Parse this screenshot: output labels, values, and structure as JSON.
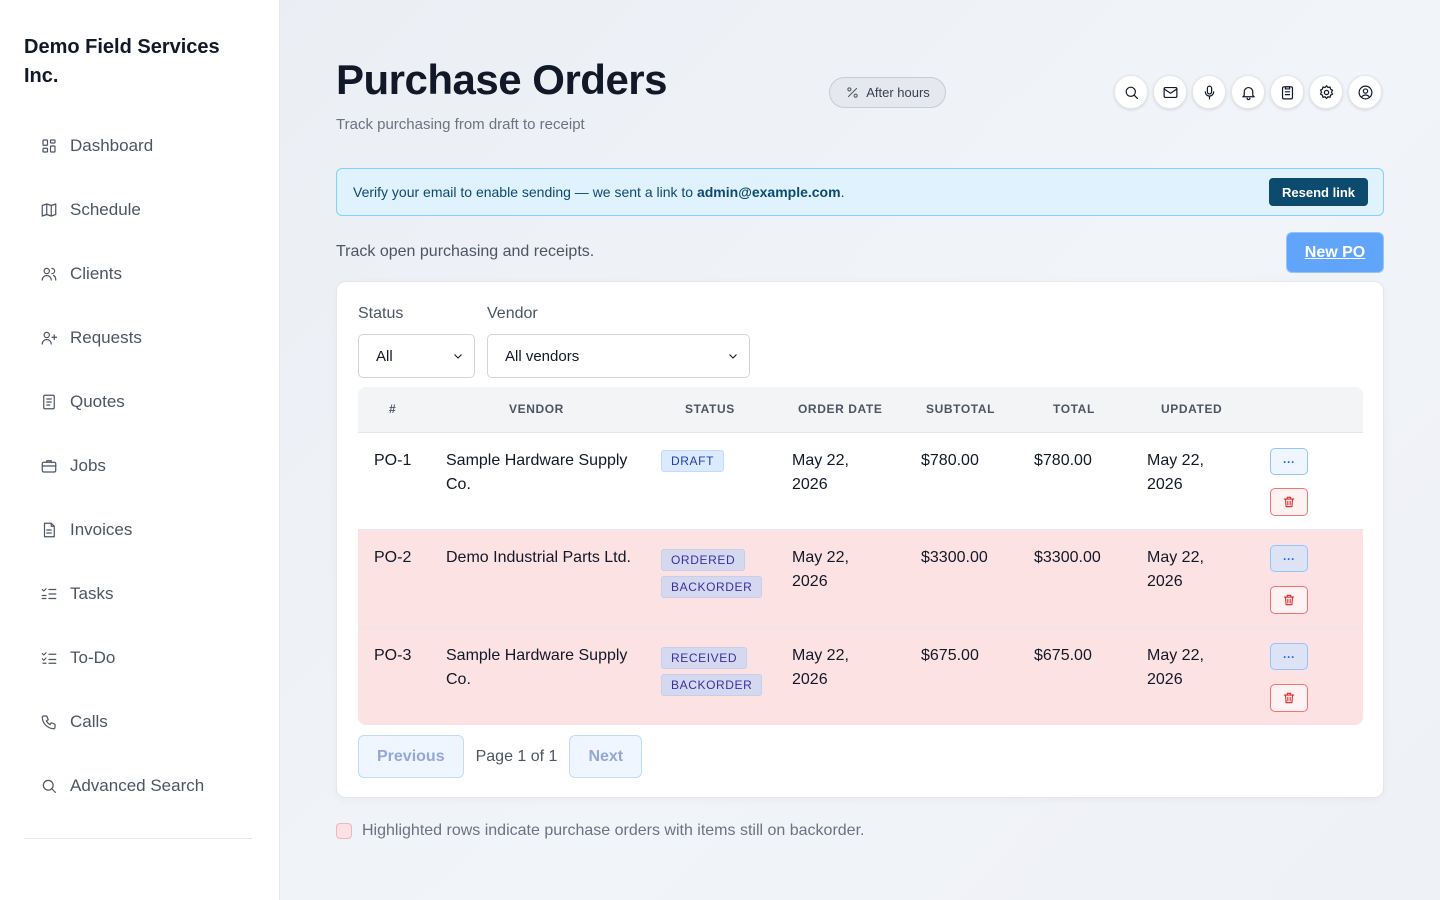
{
  "brand": "Demo Field Services Inc.",
  "nav": [
    {
      "label": "Dashboard",
      "icon": "dashboard-icon"
    },
    {
      "label": "Schedule",
      "icon": "map-icon"
    },
    {
      "label": "Clients",
      "icon": "users-icon"
    },
    {
      "label": "Requests",
      "icon": "user-plus-icon"
    },
    {
      "label": "Quotes",
      "icon": "document-icon"
    },
    {
      "label": "Jobs",
      "icon": "briefcase-icon"
    },
    {
      "label": "Invoices",
      "icon": "invoice-icon"
    },
    {
      "label": "Tasks",
      "icon": "list-check-icon"
    },
    {
      "label": "To-Do",
      "icon": "checklist-icon"
    },
    {
      "label": "Calls",
      "icon": "phone-icon"
    },
    {
      "label": "Advanced Search",
      "icon": "search-icon"
    }
  ],
  "header": {
    "title": "Purchase Orders",
    "subtitle": "Track purchasing from draft to receipt",
    "status_pill": "After hours",
    "icons": [
      "search-icon",
      "mail-icon",
      "microphone-icon",
      "bell-icon",
      "clipboard-icon",
      "gear-icon",
      "user-circle-icon"
    ]
  },
  "banner": {
    "text": "Verify your email to enable sending — we sent a link to ",
    "email": "admin@example.com",
    "suffix": ".",
    "button": "Resend link"
  },
  "toolbar": {
    "description": "Track open purchasing and receipts.",
    "new_button": "New PO"
  },
  "filters": {
    "status_label": "Status",
    "status_value": "All",
    "vendor_label": "Vendor",
    "vendor_value": "All vendors"
  },
  "table": {
    "columns": [
      "#",
      "Vendor",
      "Status",
      "Order Date",
      "Subtotal",
      "Total",
      "Updated"
    ],
    "rows": [
      {
        "id": "PO-1",
        "vendor": "Sample Hardware Supply Co.",
        "statuses": [
          "DRAFT"
        ],
        "order_date": "May 22, 2026",
        "subtotal": "$780.00",
        "total": "$780.00",
        "updated": "May 22, 2026",
        "backorder": false
      },
      {
        "id": "PO-2",
        "vendor": "Demo Industrial Parts Ltd.",
        "statuses": [
          "ORDERED",
          "BACKORDER"
        ],
        "order_date": "May 22, 2026",
        "subtotal": "$3300.00",
        "total": "$3300.00",
        "updated": "May 22, 2026",
        "backorder": true
      },
      {
        "id": "PO-3",
        "vendor": "Sample Hardware Supply Co.",
        "statuses": [
          "RECEIVED",
          "BACKORDER"
        ],
        "order_date": "May 22, 2026",
        "subtotal": "$675.00",
        "total": "$675.00",
        "updated": "May 22, 2026",
        "backorder": true
      }
    ],
    "more_label": "···"
  },
  "pagination": {
    "previous": "Previous",
    "page_text": "Page 1 of 1",
    "next": "Next"
  },
  "legend": "Highlighted rows indicate purchase orders with items still on backorder.",
  "colors": {
    "backorder_row": "#fde2e4",
    "primary": "#60a5fa",
    "banner_bg": "#e0f2fe"
  }
}
